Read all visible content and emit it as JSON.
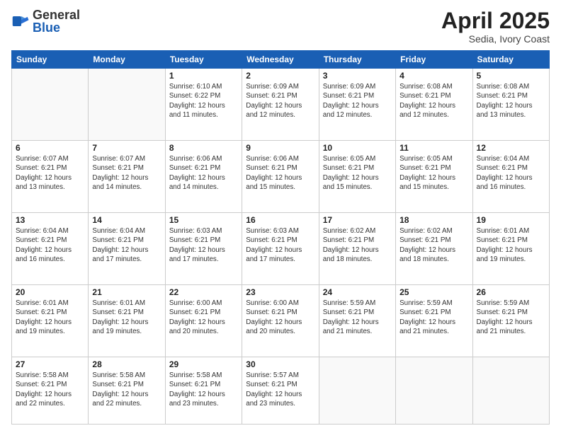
{
  "logo": {
    "general": "General",
    "blue": "Blue"
  },
  "header": {
    "title": "April 2025",
    "subtitle": "Sedia, Ivory Coast"
  },
  "weekdays": [
    "Sunday",
    "Monday",
    "Tuesday",
    "Wednesday",
    "Thursday",
    "Friday",
    "Saturday"
  ],
  "weeks": [
    [
      {
        "day": "",
        "info": ""
      },
      {
        "day": "",
        "info": ""
      },
      {
        "day": "1",
        "info": "Sunrise: 6:10 AM\nSunset: 6:22 PM\nDaylight: 12 hours and 11 minutes."
      },
      {
        "day": "2",
        "info": "Sunrise: 6:09 AM\nSunset: 6:21 PM\nDaylight: 12 hours and 12 minutes."
      },
      {
        "day": "3",
        "info": "Sunrise: 6:09 AM\nSunset: 6:21 PM\nDaylight: 12 hours and 12 minutes."
      },
      {
        "day": "4",
        "info": "Sunrise: 6:08 AM\nSunset: 6:21 PM\nDaylight: 12 hours and 12 minutes."
      },
      {
        "day": "5",
        "info": "Sunrise: 6:08 AM\nSunset: 6:21 PM\nDaylight: 12 hours and 13 minutes."
      }
    ],
    [
      {
        "day": "6",
        "info": "Sunrise: 6:07 AM\nSunset: 6:21 PM\nDaylight: 12 hours and 13 minutes."
      },
      {
        "day": "7",
        "info": "Sunrise: 6:07 AM\nSunset: 6:21 PM\nDaylight: 12 hours and 14 minutes."
      },
      {
        "day": "8",
        "info": "Sunrise: 6:06 AM\nSunset: 6:21 PM\nDaylight: 12 hours and 14 minutes."
      },
      {
        "day": "9",
        "info": "Sunrise: 6:06 AM\nSunset: 6:21 PM\nDaylight: 12 hours and 15 minutes."
      },
      {
        "day": "10",
        "info": "Sunrise: 6:05 AM\nSunset: 6:21 PM\nDaylight: 12 hours and 15 minutes."
      },
      {
        "day": "11",
        "info": "Sunrise: 6:05 AM\nSunset: 6:21 PM\nDaylight: 12 hours and 15 minutes."
      },
      {
        "day": "12",
        "info": "Sunrise: 6:04 AM\nSunset: 6:21 PM\nDaylight: 12 hours and 16 minutes."
      }
    ],
    [
      {
        "day": "13",
        "info": "Sunrise: 6:04 AM\nSunset: 6:21 PM\nDaylight: 12 hours and 16 minutes."
      },
      {
        "day": "14",
        "info": "Sunrise: 6:04 AM\nSunset: 6:21 PM\nDaylight: 12 hours and 17 minutes."
      },
      {
        "day": "15",
        "info": "Sunrise: 6:03 AM\nSunset: 6:21 PM\nDaylight: 12 hours and 17 minutes."
      },
      {
        "day": "16",
        "info": "Sunrise: 6:03 AM\nSunset: 6:21 PM\nDaylight: 12 hours and 17 minutes."
      },
      {
        "day": "17",
        "info": "Sunrise: 6:02 AM\nSunset: 6:21 PM\nDaylight: 12 hours and 18 minutes."
      },
      {
        "day": "18",
        "info": "Sunrise: 6:02 AM\nSunset: 6:21 PM\nDaylight: 12 hours and 18 minutes."
      },
      {
        "day": "19",
        "info": "Sunrise: 6:01 AM\nSunset: 6:21 PM\nDaylight: 12 hours and 19 minutes."
      }
    ],
    [
      {
        "day": "20",
        "info": "Sunrise: 6:01 AM\nSunset: 6:21 PM\nDaylight: 12 hours and 19 minutes."
      },
      {
        "day": "21",
        "info": "Sunrise: 6:01 AM\nSunset: 6:21 PM\nDaylight: 12 hours and 19 minutes."
      },
      {
        "day": "22",
        "info": "Sunrise: 6:00 AM\nSunset: 6:21 PM\nDaylight: 12 hours and 20 minutes."
      },
      {
        "day": "23",
        "info": "Sunrise: 6:00 AM\nSunset: 6:21 PM\nDaylight: 12 hours and 20 minutes."
      },
      {
        "day": "24",
        "info": "Sunrise: 5:59 AM\nSunset: 6:21 PM\nDaylight: 12 hours and 21 minutes."
      },
      {
        "day": "25",
        "info": "Sunrise: 5:59 AM\nSunset: 6:21 PM\nDaylight: 12 hours and 21 minutes."
      },
      {
        "day": "26",
        "info": "Sunrise: 5:59 AM\nSunset: 6:21 PM\nDaylight: 12 hours and 21 minutes."
      }
    ],
    [
      {
        "day": "27",
        "info": "Sunrise: 5:58 AM\nSunset: 6:21 PM\nDaylight: 12 hours and 22 minutes."
      },
      {
        "day": "28",
        "info": "Sunrise: 5:58 AM\nSunset: 6:21 PM\nDaylight: 12 hours and 22 minutes."
      },
      {
        "day": "29",
        "info": "Sunrise: 5:58 AM\nSunset: 6:21 PM\nDaylight: 12 hours and 23 minutes."
      },
      {
        "day": "30",
        "info": "Sunrise: 5:57 AM\nSunset: 6:21 PM\nDaylight: 12 hours and 23 minutes."
      },
      {
        "day": "",
        "info": ""
      },
      {
        "day": "",
        "info": ""
      },
      {
        "day": "",
        "info": ""
      }
    ]
  ]
}
